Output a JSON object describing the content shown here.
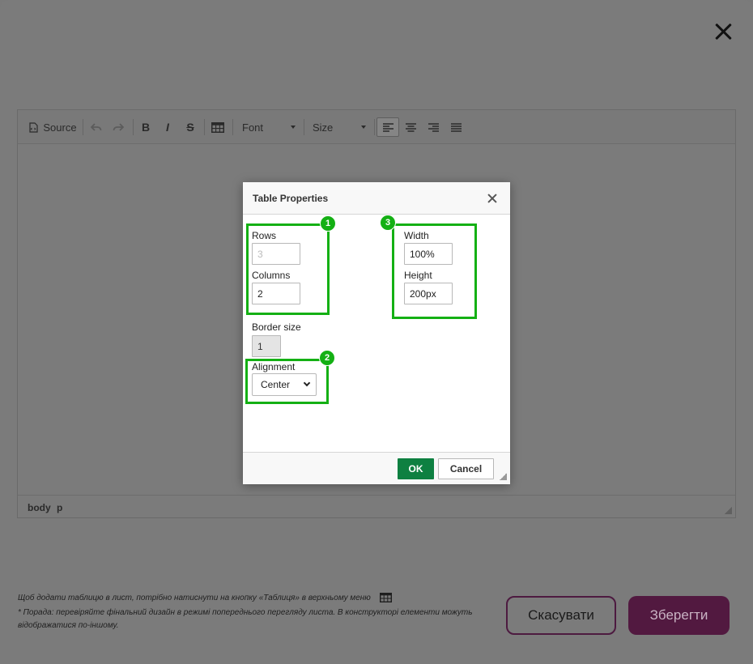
{
  "editor": {
    "toolbar": {
      "source_label": "Source",
      "font_label": "Font",
      "size_label": "Size"
    },
    "status": {
      "path": [
        "body",
        "p"
      ]
    }
  },
  "dialog": {
    "title": "Table Properties",
    "rows": {
      "label": "Rows",
      "value": "3"
    },
    "columns": {
      "label": "Columns",
      "value": "2"
    },
    "width": {
      "label": "Width",
      "value": "100%"
    },
    "height": {
      "label": "Height",
      "value": "200px"
    },
    "border": {
      "label": "Border size",
      "value": "1"
    },
    "alignment": {
      "label": "Alignment",
      "value": "Center"
    },
    "ok_label": "OK",
    "cancel_label": "Cancel"
  },
  "annotations": [
    {
      "number": "1"
    },
    {
      "number": "2"
    },
    {
      "number": "3"
    }
  ],
  "hints": {
    "line1": "Щоб додати таблицю в лист, потрібно натиснути на кнопку «Таблиця» в верхньому меню",
    "line2": "* Порада: перевіряйте фінальний дизайн в режимі попереднього перегляду листа. В конструкторі елементи можуть",
    "line3": "відображатися по-іншому."
  },
  "footer": {
    "cancel_label": "Скасувати",
    "save_label": "Зберегти"
  },
  "colors": {
    "annotation_green": "#14b014",
    "ok_green": "#0e8041",
    "save_button": "#521940"
  }
}
